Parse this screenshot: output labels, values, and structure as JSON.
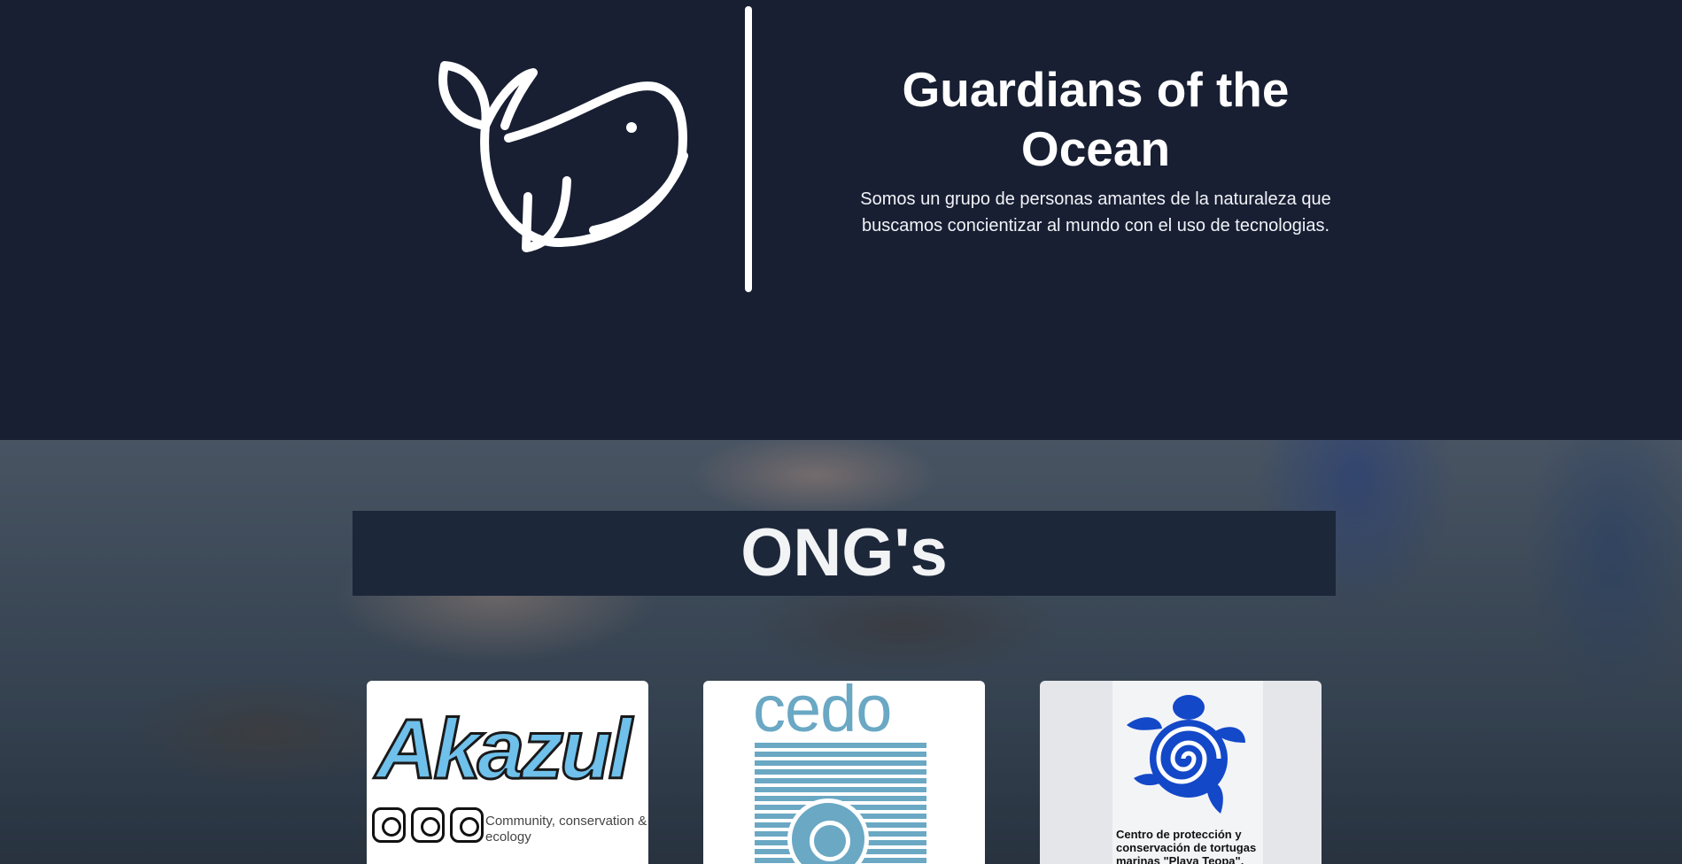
{
  "hero": {
    "title": "Guardians of the Ocean",
    "description": "Somos un grupo de personas amantes de la naturaleza que buscamos concientizar al mundo con el uso de tecnologias.",
    "logo_icon": "whale-icon"
  },
  "ngos": {
    "heading": "ONG's",
    "cards": [
      {
        "name": "Akazul",
        "tagline": "Community, conservation & ecology"
      },
      {
        "name": "cedo"
      },
      {
        "caption": "Centro de protección y conservación de tortugas marinas \"Playa Teopa\"."
      }
    ]
  },
  "colors": {
    "hero_bg": "#181f33",
    "banner_bg": "#1d273a",
    "akazul_blue": "#6fc0ea",
    "cedo_blue": "#6aa8c4",
    "turtle_blue": "#1348c8"
  }
}
